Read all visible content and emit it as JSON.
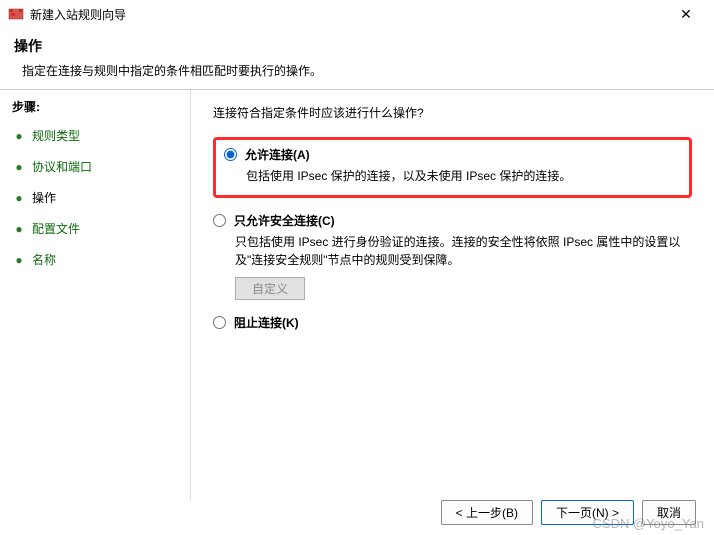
{
  "titlebar": {
    "title": "新建入站规则向导"
  },
  "header": {
    "title": "操作",
    "subtitle": "指定在连接与规则中指定的条件相匹配时要执行的操作。"
  },
  "sidebar": {
    "title": "步骤:",
    "steps": [
      {
        "label": "规则类型"
      },
      {
        "label": "协议和端口"
      },
      {
        "label": "操作"
      },
      {
        "label": "配置文件"
      },
      {
        "label": "名称"
      }
    ]
  },
  "main": {
    "question": "连接符合指定条件时应该进行什么操作?",
    "options": [
      {
        "label": "允许连接(A)",
        "desc": "包括使用 IPsec 保护的连接，以及未使用 IPsec 保护的连接。"
      },
      {
        "label": "只允许安全连接(C)",
        "desc": "只包括使用 IPsec 进行身份验证的连接。连接的安全性将依照 IPsec 属性中的设置以及\"连接安全规则\"节点中的规则受到保障。",
        "custom_btn": "自定义"
      },
      {
        "label": "阻止连接(K)"
      }
    ]
  },
  "footer": {
    "back": "< 上一步(B)",
    "next": "下一页(N) >",
    "cancel": "取消"
  },
  "watermark": "CSDN @Yoyo_Yan"
}
